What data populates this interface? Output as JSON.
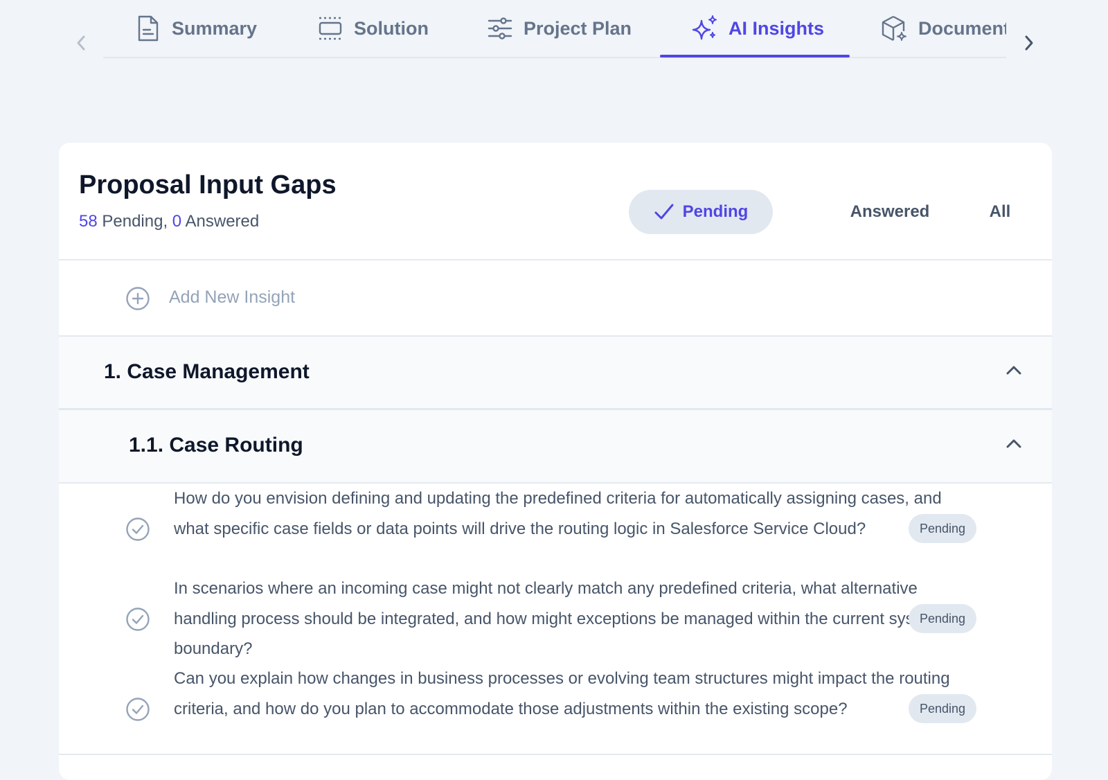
{
  "tabs": [
    {
      "label": "Summary",
      "icon": "document-icon",
      "active": false
    },
    {
      "label": "Solution",
      "icon": "solution-frame-icon",
      "active": false
    },
    {
      "label": "Project Plan",
      "icon": "sliders-icon",
      "active": false
    },
    {
      "label": "AI Insights",
      "icon": "sparkles-icon",
      "active": true
    },
    {
      "label": "Document",
      "icon": "cube-sparkle-icon",
      "active": false
    }
  ],
  "card": {
    "title": "Proposal Input Gaps",
    "pending_count": "58",
    "pending_label": "Pending,",
    "answered_count": "0",
    "answered_label": "Answered"
  },
  "filters": {
    "pending": "Pending",
    "answered": "Answered",
    "all": "All",
    "selected": "Pending"
  },
  "add_insight": "Add New Insight",
  "sections": [
    {
      "title": "1. Case Management",
      "subsections": [
        {
          "title": "1.1. Case Routing",
          "questions": [
            {
              "text": "How do you envision defining and updating the predefined criteria for automatically assigning cases, and what specific case fields or data points will drive the routing logic in Salesforce Service Cloud?",
              "status": "Pending"
            },
            {
              "text": "In scenarios where an incoming case might not clearly match any predefined criteria, what alternative handling process should be integrated, and how might exceptions be managed within the current system boundary?",
              "status": "Pending"
            },
            {
              "text": "Can you explain how changes in business processes or evolving team structures might impact the routing criteria, and how do you plan to accommodate those adjustments within the existing scope?",
              "status": "Pending"
            }
          ]
        }
      ]
    }
  ],
  "colors": {
    "accent": "#4f46e5",
    "text_muted": "#64748b",
    "background": "#f1f4f8"
  }
}
